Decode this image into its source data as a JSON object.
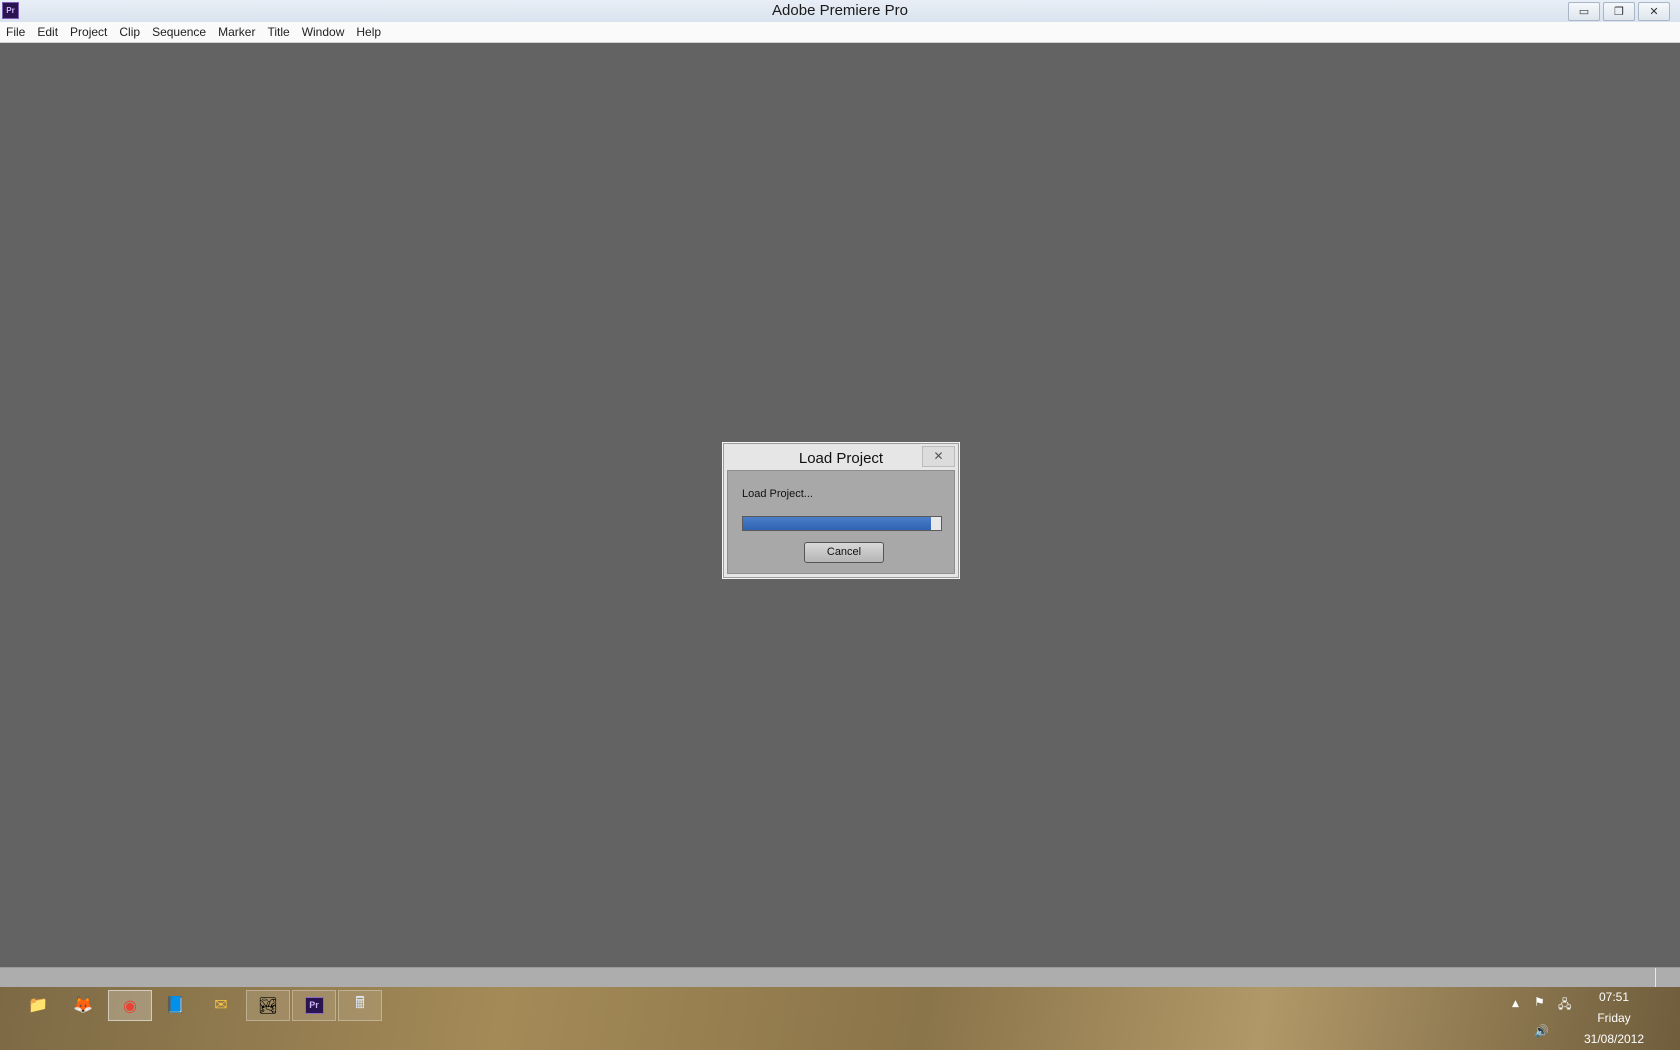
{
  "window": {
    "title": "Adobe Premiere Pro",
    "app_icon_label": "Pr",
    "minimize_icon": "minimize-icon",
    "restore_icon": "restore-icon",
    "close_icon": "close-icon"
  },
  "menu": {
    "items": [
      "File",
      "Edit",
      "Project",
      "Clip",
      "Sequence",
      "Marker",
      "Title",
      "Window",
      "Help"
    ]
  },
  "dialog": {
    "title": "Load Project",
    "message": "Load Project...",
    "progress": 0.95,
    "cancel_label": "Cancel",
    "close_glyph": "✕"
  },
  "taskbar": {
    "apps": [
      {
        "name": "file-explorer-icon",
        "glyph": "📁",
        "state": "pinned"
      },
      {
        "name": "firefox-icon",
        "glyph": "🦊",
        "state": "pinned"
      },
      {
        "name": "chrome-icon",
        "glyph": "◉",
        "state": "active"
      },
      {
        "name": "notepad-icon",
        "glyph": "📘",
        "state": "pinned"
      },
      {
        "name": "mail-icon",
        "glyph": "✉",
        "state": "pinned"
      },
      {
        "name": "photos-icon",
        "glyph": "🏞",
        "state": "running"
      },
      {
        "name": "premiere-icon",
        "glyph": "Pr",
        "state": "running"
      },
      {
        "name": "calculator-icon",
        "glyph": "🖩",
        "state": "running"
      }
    ],
    "clock": {
      "time": "07:51",
      "day": "Friday",
      "date": "31/08/2012"
    }
  },
  "colors": {
    "workspace": "#636363",
    "progress_fill": "#3a6fbf",
    "premiere_purple": "#2a1450"
  }
}
